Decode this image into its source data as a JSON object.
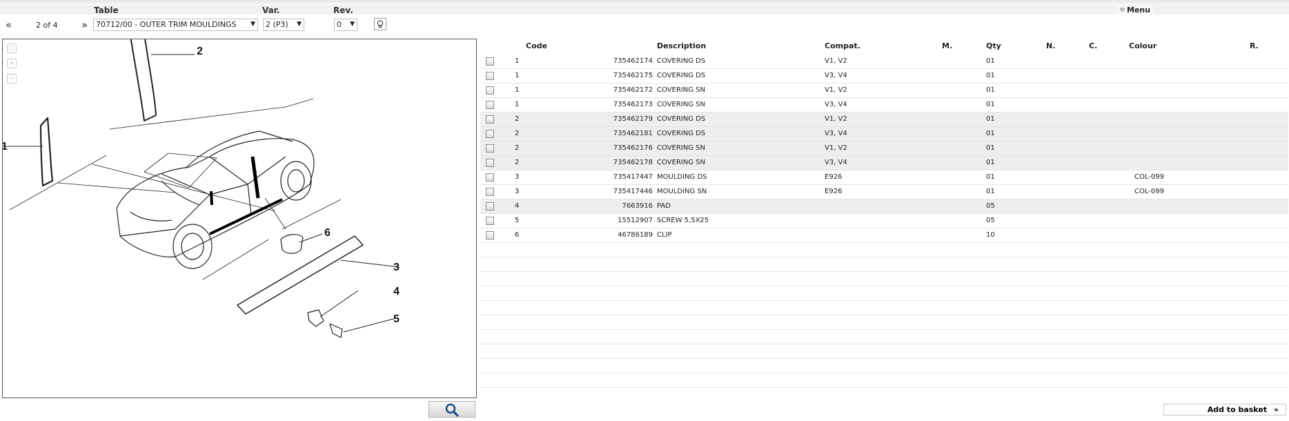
{
  "header": {
    "table_label": "Table",
    "var_label": "Var.",
    "rev_label": "Rev.",
    "menu_label": "Menu",
    "menu_icon": "heart-icon"
  },
  "nav": {
    "first": "«",
    "page_info": "2 of 4",
    "next": "»"
  },
  "selectors": {
    "table": "70712/00 - OUTER TRIM MOULDINGS",
    "variant": "2 (P3)",
    "revision": "0"
  },
  "drawing": {
    "callouts": [
      "2",
      "1",
      "6",
      "3",
      "4",
      "5"
    ]
  },
  "grid": {
    "columns": {
      "code": "Code",
      "description": "Description",
      "compat": "Compat.",
      "m": "M.",
      "qty": "Qty",
      "n": "N.",
      "c": "C.",
      "colour": "Colour",
      "r": "R."
    },
    "rows": [
      {
        "ref": "1",
        "code": "735462174",
        "desc": "COVERING DS",
        "compat": "V1, V2",
        "qty": "01",
        "colour": ""
      },
      {
        "ref": "1",
        "code": "735462175",
        "desc": "COVERING DS",
        "compat": "V3, V4",
        "qty": "01",
        "colour": ""
      },
      {
        "ref": "1",
        "code": "735462172",
        "desc": "COVERING SN",
        "compat": "V1, V2",
        "qty": "01",
        "colour": ""
      },
      {
        "ref": "1",
        "code": "735462173",
        "desc": "COVERING SN",
        "compat": "V3, V4",
        "qty": "01",
        "colour": ""
      },
      {
        "ref": "2",
        "code": "735462179",
        "desc": "COVERING DS",
        "compat": "V1, V2",
        "qty": "01",
        "colour": ""
      },
      {
        "ref": "2",
        "code": "735462181",
        "desc": "COVERING DS",
        "compat": "V3, V4",
        "qty": "01",
        "colour": ""
      },
      {
        "ref": "2",
        "code": "735462176",
        "desc": "COVERING SN",
        "compat": "V1, V2",
        "qty": "01",
        "colour": ""
      },
      {
        "ref": "2",
        "code": "735462178",
        "desc": "COVERING SN",
        "compat": "V3, V4",
        "qty": "01",
        "colour": ""
      },
      {
        "ref": "3",
        "code": "735417447",
        "desc": "MOULDING DS",
        "compat": "E926",
        "qty": "01",
        "colour": "COL-099"
      },
      {
        "ref": "3",
        "code": "735417446",
        "desc": "MOULDING SN",
        "compat": "E926",
        "qty": "01",
        "colour": "COL-099"
      },
      {
        "ref": "4",
        "code": "7663916",
        "desc": "PAD",
        "compat": "",
        "qty": "05",
        "colour": ""
      },
      {
        "ref": "5",
        "code": "15512907",
        "desc": "SCREW 5,5X25",
        "compat": "",
        "qty": "05",
        "colour": ""
      },
      {
        "ref": "6",
        "code": "46786189",
        "desc": "CLIP",
        "compat": "",
        "qty": "10",
        "colour": ""
      }
    ],
    "alt_rows": [
      4,
      5,
      6,
      7,
      10
    ]
  },
  "footer": {
    "basket_label": "Add to basket",
    "basket_arrow": "»",
    "search_icon": "magnifier-icon"
  },
  "colors": {
    "accent": "#1f4e8c",
    "row_alt": "#eeeeee",
    "border": "#555555"
  }
}
